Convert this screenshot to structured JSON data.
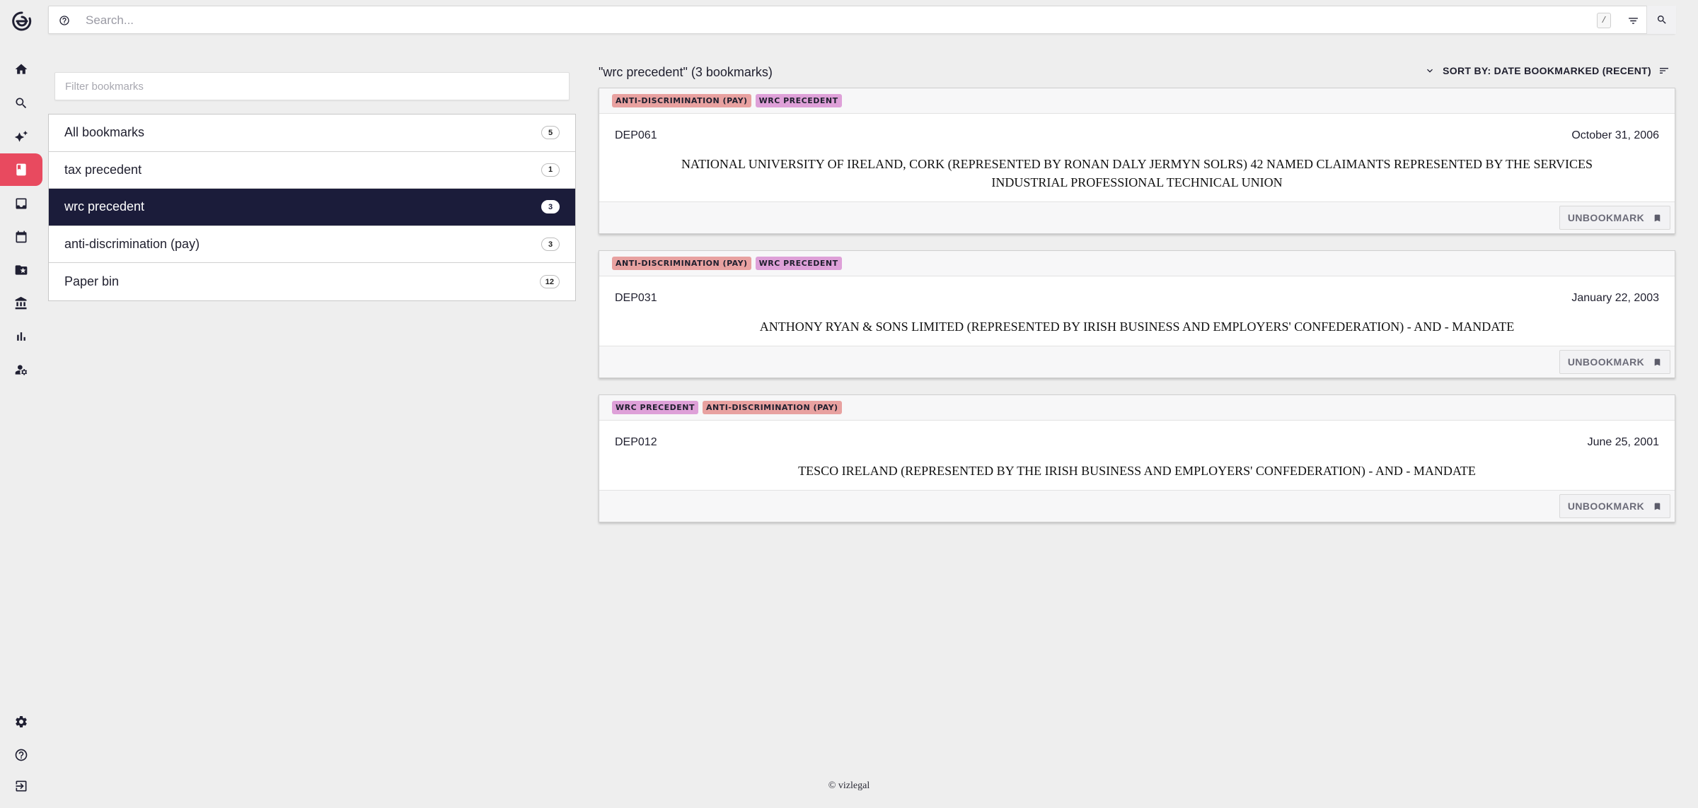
{
  "search": {
    "placeholder": "Search...",
    "shortcut": "/"
  },
  "nav": {
    "items": [
      {
        "name": "home-icon"
      },
      {
        "name": "search-icon"
      },
      {
        "name": "sparkle-icon"
      },
      {
        "name": "bookmark-icon",
        "active": true
      },
      {
        "name": "inbox-icon"
      },
      {
        "name": "calendar-icon"
      },
      {
        "name": "folder-star-icon"
      },
      {
        "name": "institution-icon"
      },
      {
        "name": "bar-chart-icon"
      },
      {
        "name": "user-manage-icon"
      }
    ],
    "bottom": [
      {
        "name": "settings-icon"
      },
      {
        "name": "help-icon"
      },
      {
        "name": "logout-icon"
      }
    ]
  },
  "bookmarks": {
    "filter_placeholder": "Filter bookmarks",
    "lists": [
      {
        "label": "All bookmarks",
        "count": "5"
      },
      {
        "label": "tax precedent",
        "count": "1"
      },
      {
        "label": "wrc precedent",
        "count": "3",
        "selected": true
      },
      {
        "label": "anti-discrimination (pay)",
        "count": "3"
      },
      {
        "label": "Paper bin",
        "count": "12"
      }
    ]
  },
  "results": {
    "title": "\"wrc precedent\" (3 bookmarks)",
    "sort_label": "SORT BY: DATE BOOKMARKED (RECENT)",
    "unbookmark_label": "UNBOOKMARK",
    "cards": [
      {
        "tags": [
          "ANTI-DISCRIMINATION (PAY)",
          "WRC PRECEDENT"
        ],
        "tag_kinds": [
          "anti",
          "wrc"
        ],
        "code": "DEP061",
        "date": "October 31, 2006",
        "title": "NATIONAL UNIVERSITY OF IRELAND, CORK (REPRESENTED BY RONAN DALY JERMYN SOLRS) 42 NAMED CLAIMANTS REPRESENTED BY THE SERVICES INDUSTRIAL PROFESSIONAL TECHNICAL UNION"
      },
      {
        "tags": [
          "ANTI-DISCRIMINATION (PAY)",
          "WRC PRECEDENT"
        ],
        "tag_kinds": [
          "anti",
          "wrc"
        ],
        "code": "DEP031",
        "date": "January 22, 2003",
        "title": "ANTHONY RYAN & SONS LIMITED (REPRESENTED BY IRISH BUSINESS AND EMPLOYERS' CONFEDERATION) - AND - MANDATE"
      },
      {
        "tags": [
          "WRC PRECEDENT",
          "ANTI-DISCRIMINATION (PAY)"
        ],
        "tag_kinds": [
          "wrc",
          "anti"
        ],
        "code": "DEP012",
        "date": "June 25, 2001",
        "title": "TESCO IRELAND (REPRESENTED BY THE IRISH BUSINESS AND EMPLOYERS' CONFEDERATION) - AND - MANDATE"
      }
    ]
  },
  "footer": {
    "text": "© vizlegal"
  },
  "colors": {
    "accent": "#e84a5f",
    "selected_bg": "#1b1c3a",
    "tag_anti": "#e8a1a0",
    "tag_wrc": "#dea0d8"
  }
}
